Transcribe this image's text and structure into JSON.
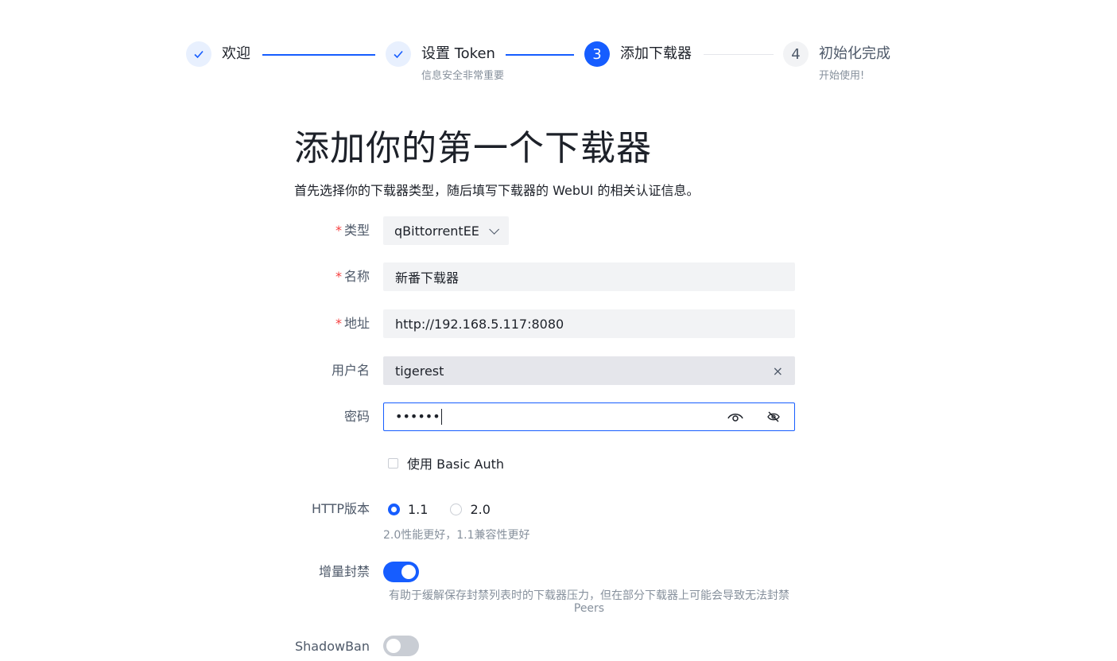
{
  "steps": [
    {
      "title": "欢迎",
      "desc": "",
      "status": "done"
    },
    {
      "title": "设置 Token",
      "desc": "信息安全非常重要",
      "status": "done"
    },
    {
      "title": "添加下载器",
      "desc": "",
      "status": "active",
      "number": "3"
    },
    {
      "title": "初始化完成",
      "desc": "开始使用!",
      "status": "wait",
      "number": "4"
    }
  ],
  "page": {
    "title": "添加你的第一个下载器",
    "description": "首先选择你的下载器类型，随后填写下载器的 WebUI 的相关认证信息。"
  },
  "form": {
    "required_mark": "*",
    "type": {
      "label": "类型",
      "value": "qBittorrentEE"
    },
    "name": {
      "label": "名称",
      "value": "新番下载器"
    },
    "address": {
      "label": "地址",
      "value": "http://192.168.5.117:8080"
    },
    "username": {
      "label": "用户名",
      "value": "tigerest",
      "clear_icon": "×"
    },
    "password": {
      "label": "密码",
      "value": "••••••"
    },
    "basic_auth": {
      "label": "使用 Basic Auth",
      "checked": false
    },
    "http_version": {
      "label": "HTTP版本",
      "options": [
        "1.1",
        "2.0"
      ],
      "selected": "1.1",
      "help": "2.0性能更好，1.1兼容性更好"
    },
    "incremental_ban": {
      "label": "增量封禁",
      "enabled": true,
      "help_line1": "有助于缓解保存封禁列表时的下载器压力，但在部分下载器上可能会导致无法封禁",
      "help_line2": "Peers"
    },
    "shadowban": {
      "label": "ShadowBan",
      "enabled": false
    }
  },
  "colors": {
    "primary": "#165dff",
    "required": "#f53f3f"
  }
}
